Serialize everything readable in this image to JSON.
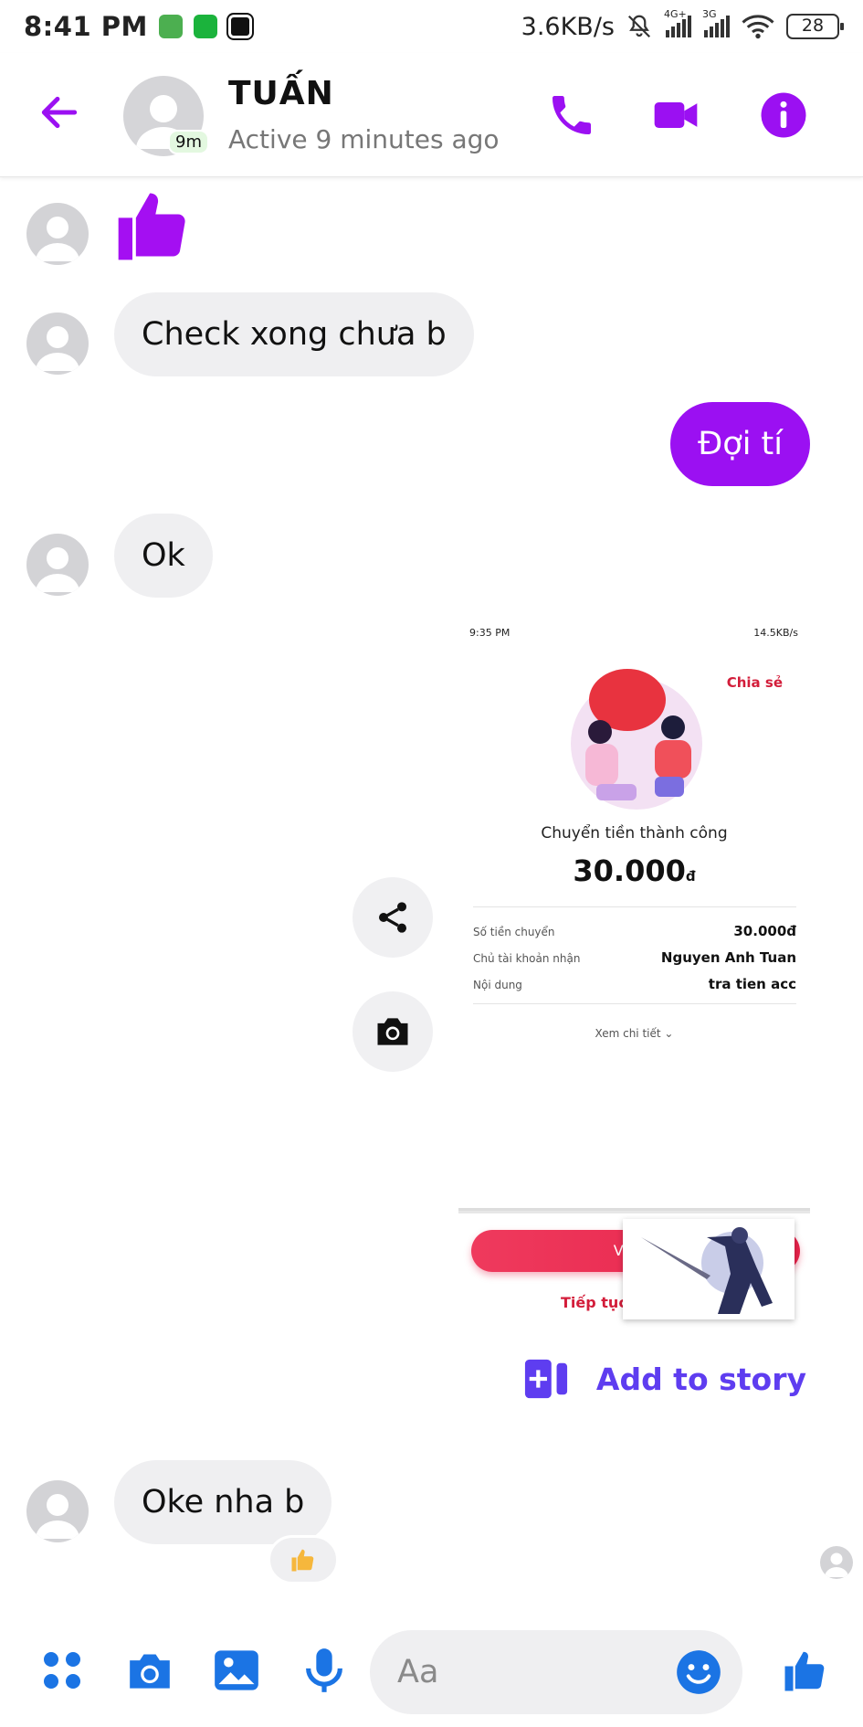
{
  "status_bar": {
    "time": "8:41 PM",
    "net_speed": "3.6KB/s",
    "sig1_tag": "4G+",
    "sig2_tag": "3G",
    "battery": "28"
  },
  "header": {
    "name": "TUẤN",
    "status": "Active 9 minutes ago",
    "active_badge": "9m"
  },
  "messages": {
    "m2": "Check xong chưa b",
    "m3": "Đợi tí",
    "m4": "Ok",
    "m6": "Oke nha b"
  },
  "shared_screenshot": {
    "status_time": "9:35 PM",
    "status_net": "14.5KB/s",
    "share_label": "Chia sẻ",
    "caption": "Chuyển tiền thành công",
    "amount": "30.000",
    "currency": "đ",
    "rows": [
      {
        "key": "Số tiền chuyển",
        "value": "30.000đ"
      },
      {
        "key": "Chủ tài khoản nhận",
        "value": "Nguyen Anh Tuan"
      },
      {
        "key": "Nội dung",
        "value": "tra tien acc"
      }
    ],
    "more_label": "Xem chi tiết",
    "pill_label": "Về tra",
    "continue_label": "Tiếp tục"
  },
  "add_to_story": "Add to story",
  "composer": {
    "placeholder": "Aa"
  },
  "colors": {
    "accent": "#9b10f2",
    "blue_icons": "#1b74e4",
    "story": "#5e3df0"
  }
}
